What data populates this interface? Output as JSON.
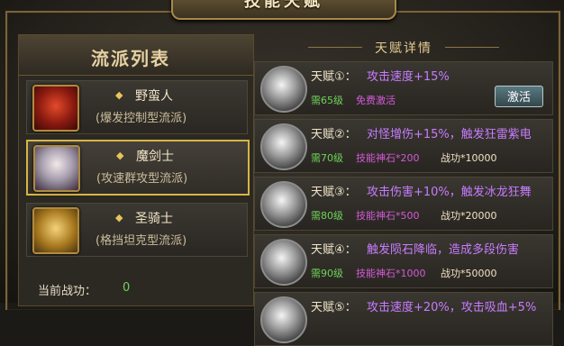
{
  "title": "技能天赋",
  "schools": {
    "header": "流派列表",
    "items": [
      {
        "name": "野蛮人",
        "desc": "(爆发控制型流派)",
        "avatar": "barbarian-portrait"
      },
      {
        "name": "魔剑士",
        "desc": "(攻速群攻型流派)",
        "avatar": "magic-swordsman-portrait"
      },
      {
        "name": "圣骑士",
        "desc": "(格挡坦克型流派)",
        "avatar": "paladin-portrait"
      }
    ],
    "power_label": "当前战功：",
    "power_value": "0"
  },
  "talents": {
    "header": "天赋详情",
    "items": [
      {
        "name": "天赋①：",
        "desc": "攻击速度+15%",
        "level": "需65级",
        "cost": "免费激活",
        "power": "",
        "button": "激活"
      },
      {
        "name": "天赋②：",
        "desc": "对怪增伤+15%，触发狂雷紫电",
        "level": "需70级",
        "cost": "技能神石*200",
        "power": "战功*10000",
        "button": ""
      },
      {
        "name": "天赋③：",
        "desc": "攻击伤害+10%，触发冰龙狂舞",
        "level": "需80级",
        "cost": "技能神石*500",
        "power": "战功*20000",
        "button": ""
      },
      {
        "name": "天赋④：",
        "desc": "触发陨石降临，造成多段伤害",
        "level": "需90级",
        "cost": "技能神石*1000",
        "power": "战功*50000",
        "button": ""
      },
      {
        "name": "天赋⑤：",
        "desc": "攻击速度+20%，攻击吸血+5%",
        "level": "",
        "cost": "",
        "power": "",
        "button": ""
      }
    ]
  },
  "colors": {
    "gold": "#d6b545",
    "green": "#6fd25a",
    "purple": "#c77cff"
  }
}
